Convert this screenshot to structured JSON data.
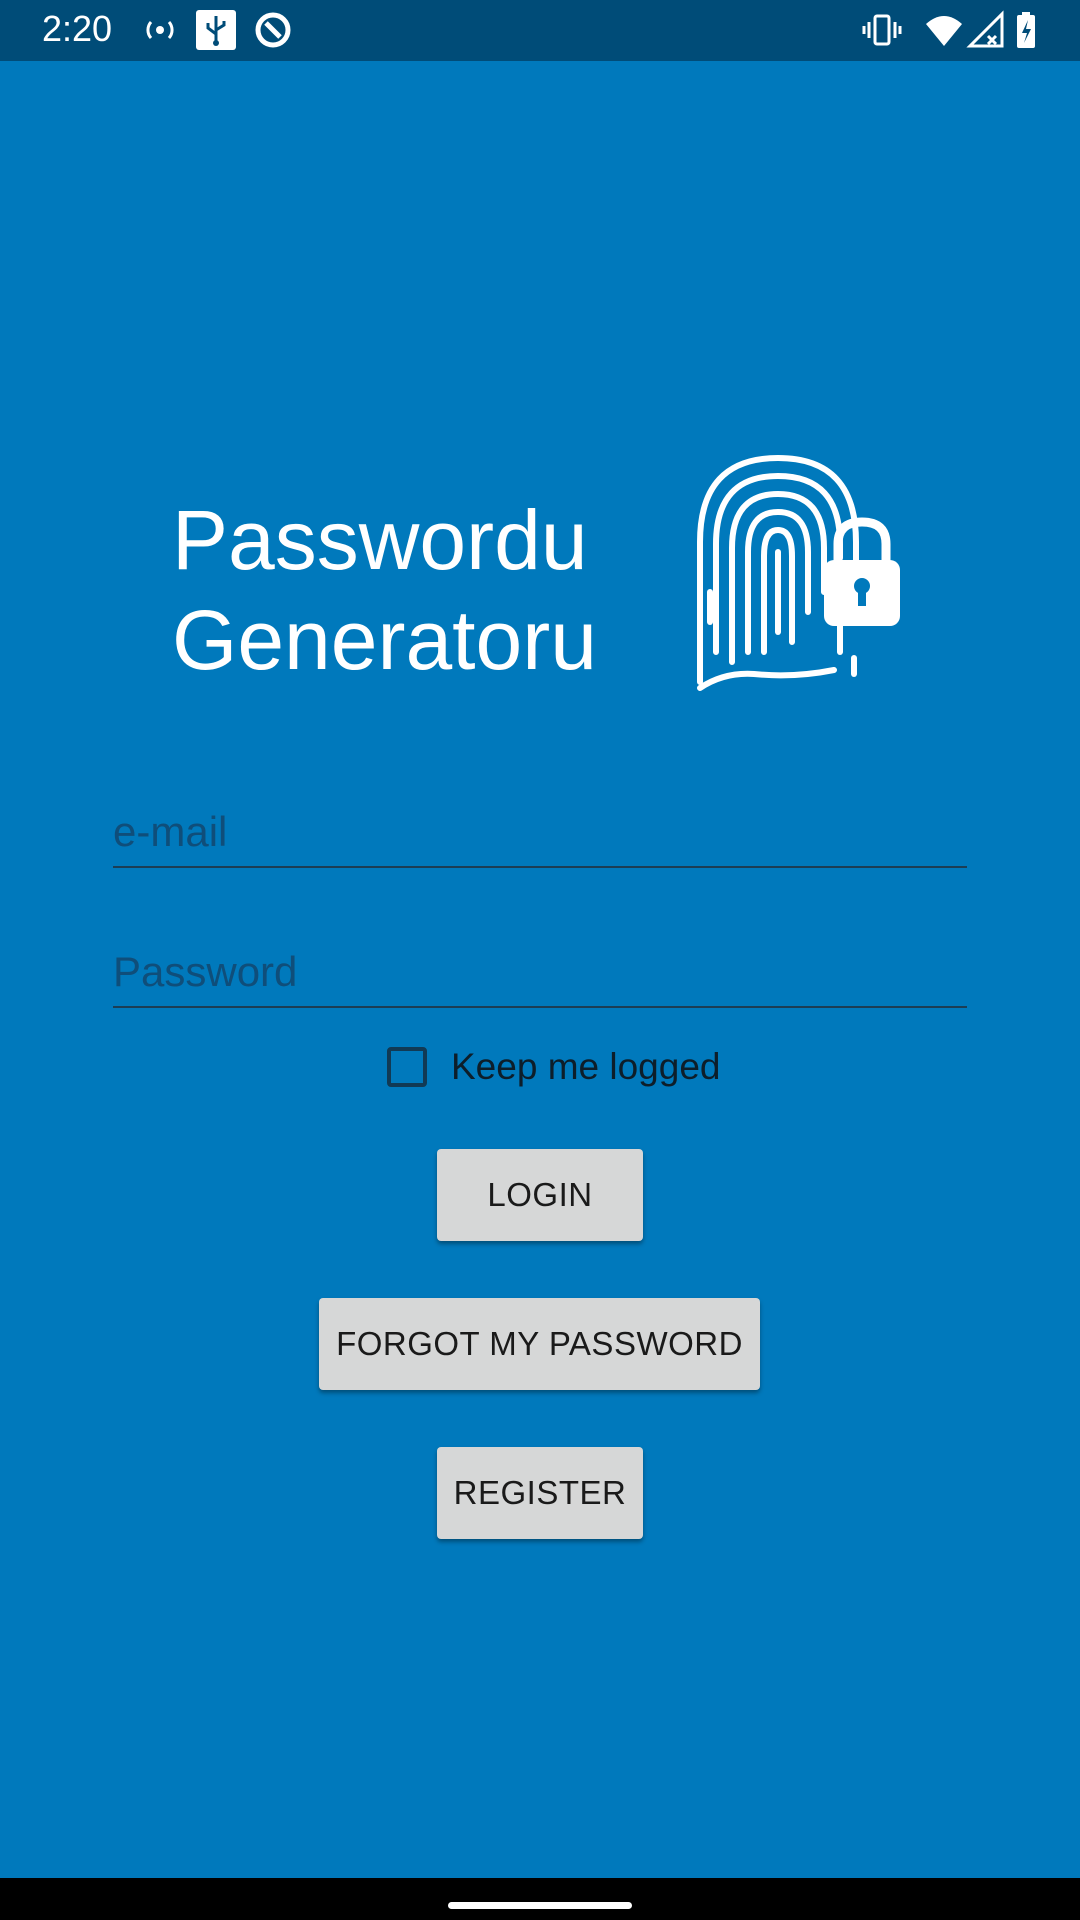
{
  "status_bar": {
    "time": "2:20",
    "left_icons": [
      "hotspot-icon",
      "usb-icon",
      "data-saver-icon"
    ],
    "right_icons": [
      "vibrate-icon",
      "wifi-icon",
      "signal-icon",
      "battery-icon"
    ]
  },
  "logo": {
    "line1": "Passwordu",
    "line2": "Generatoru",
    "icon": "fingerprint-lock-icon"
  },
  "form": {
    "email_placeholder": "e-mail",
    "password_placeholder": "Password",
    "keep_logged_label": "Keep me logged",
    "keep_logged_checked": false
  },
  "buttons": {
    "login": "LOGIN",
    "forgot": "FORGOT MY PASSWORD",
    "register": "REGISTER"
  },
  "colors": {
    "background": "#0079BC",
    "status_bar": "#004C78",
    "button": "#D6D7D7"
  }
}
